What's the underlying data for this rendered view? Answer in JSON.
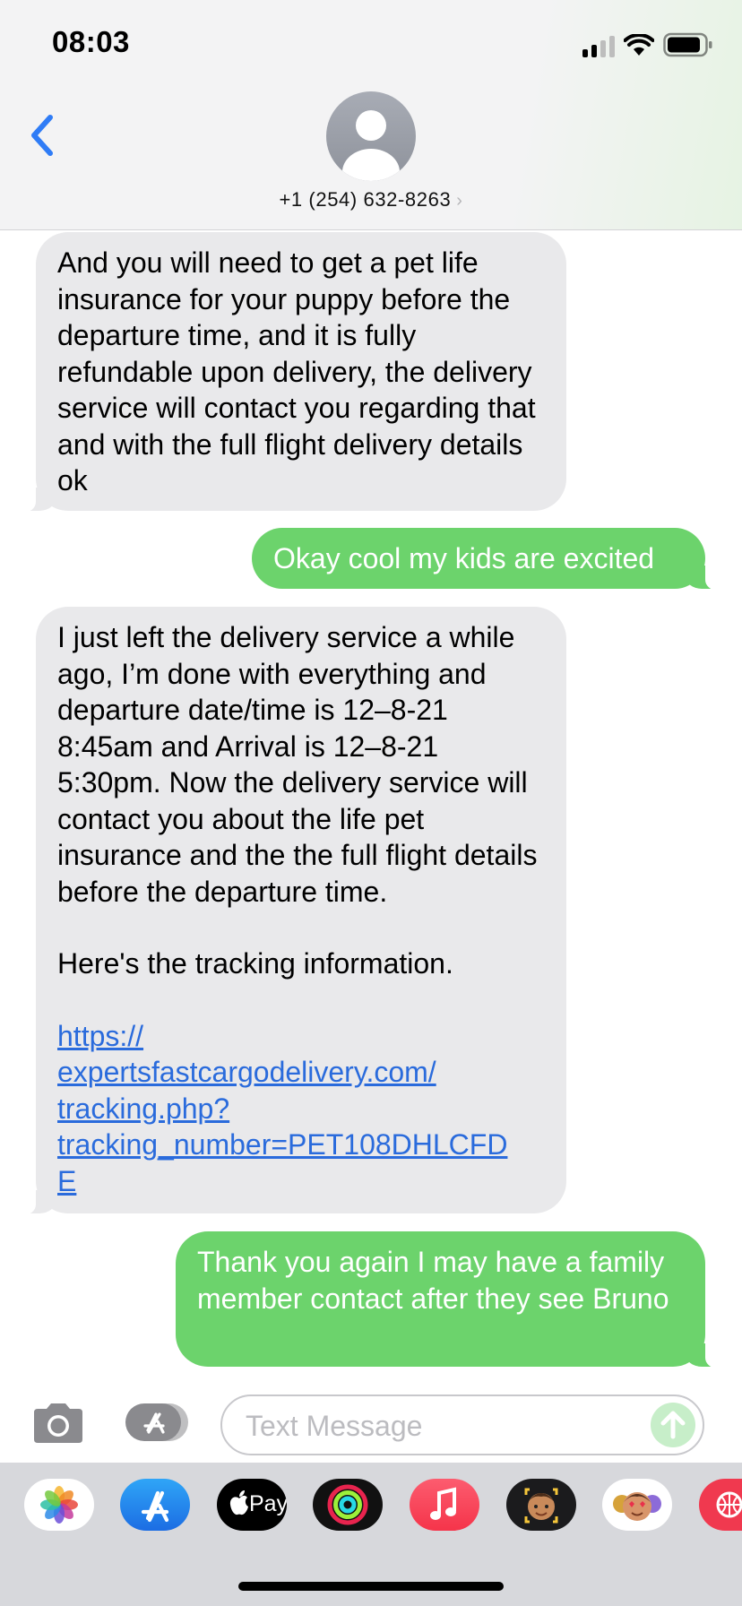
{
  "status_bar": {
    "time": "08:03"
  },
  "header": {
    "contact": "+1 (254) 632-8263",
    "chevron": "›"
  },
  "messages": [
    {
      "direction": "incoming",
      "paragraphs": [
        "And you will need to get a pet life insurance for your puppy before the departure time, and it is fully refundable upon delivery, the delivery service will contact you regarding that and with the full flight delivery details ok"
      ]
    },
    {
      "direction": "outgoing",
      "paragraphs": [
        "Okay cool my kids are excited"
      ]
    },
    {
      "direction": "incoming",
      "paragraphs": [
        "I just left the delivery service a while ago, I’m done with everything and departure date/time is 12–8-21 8:45am and Arrival is 12–8-21 5:30pm. Now the delivery service will contact you about the life pet insurance and the the full flight details before the departure time.",
        "Here's the tracking information."
      ],
      "link_lines": [
        "https://",
        "expertsfastcargodelivery.com/",
        "tracking.php?",
        "tracking_number=PET108DHLCFD",
        "E"
      ]
    },
    {
      "direction": "outgoing",
      "paragraphs": [
        "Thank you again I may have a family member contact after they see Bruno"
      ]
    }
  ],
  "input": {
    "placeholder": "Text Message"
  },
  "app_drawer": {
    "apps": [
      "photos-icon",
      "app-store-icon",
      "apple-pay-icon",
      "activity-icon",
      "music-icon",
      "memoji-icon",
      "memoji-stickers-icon",
      "search-web-icon"
    ],
    "apple_pay_label": "Pay"
  },
  "colors": {
    "incoming": "#e9e9eb",
    "outgoing": "#6cd36c",
    "link": "#2a6bdc",
    "accent": "#2f7cf6"
  }
}
